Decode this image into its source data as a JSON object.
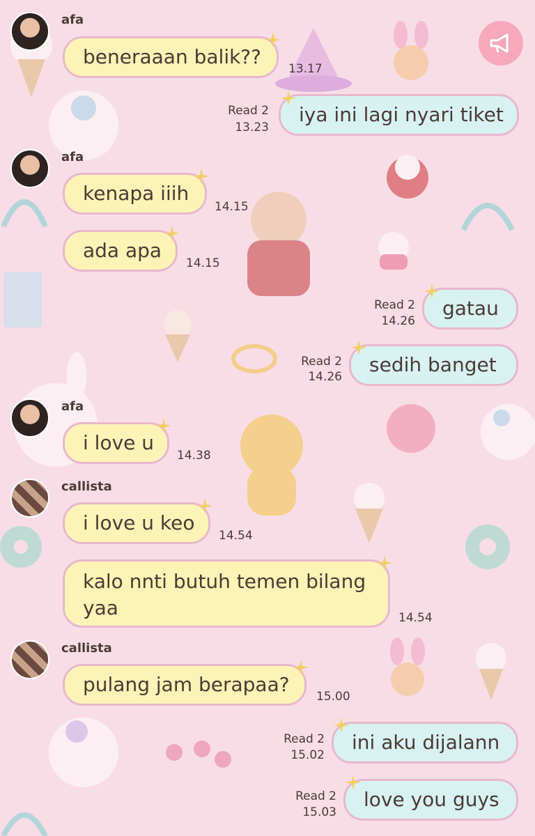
{
  "header": {
    "announcement_icon": "megaphone-icon"
  },
  "messages": [
    {
      "side": "in",
      "sender": "afa",
      "avatar": "avatar-photo-afa",
      "text": "beneraaan balik??",
      "time": "13.17"
    },
    {
      "side": "out",
      "read": "Read 2",
      "text": "iya ini lagi nyari tiket",
      "time": "13.23"
    },
    {
      "side": "in",
      "sender": "afa",
      "avatar": "avatar-photo-afa",
      "text": "kenapa iiih",
      "time": "14.15"
    },
    {
      "side": "in",
      "text": "ada apa",
      "time": "14.15"
    },
    {
      "side": "out",
      "read": "Read 2",
      "text": "gatau",
      "time": "14.26"
    },
    {
      "side": "out",
      "read": "Read 2",
      "text": "sedih banget",
      "time": "14.26"
    },
    {
      "side": "in",
      "sender": "afa",
      "avatar": "avatar-photo-afa",
      "text": "i love u",
      "time": "14.38"
    },
    {
      "side": "in",
      "sender": "callista",
      "avatar": "avatar-collage-callista",
      "text": "i love u keo",
      "time": "14.54"
    },
    {
      "side": "in",
      "text": "kalo nnti butuh temen bilang yaa",
      "time": "14.54"
    },
    {
      "side": "in",
      "sender": "callista",
      "avatar": "avatar-collage-callista",
      "text": "pulang jam berapaa?",
      "time": "15.00"
    },
    {
      "side": "out",
      "read": "Read 2",
      "text": "ini aku dijalann",
      "time": "15.02"
    },
    {
      "side": "out",
      "read": "Read 2",
      "text": "love you guys",
      "time": "15.03"
    }
  ],
  "colors": {
    "background": "#f8dde6",
    "incoming_bubble": "#fdf3b6",
    "outgoing_bubble": "#d8f2f2",
    "bubble_border": "#e8b8cc",
    "text": "#4a3b35",
    "announcement_button": "#f6a8bd"
  }
}
